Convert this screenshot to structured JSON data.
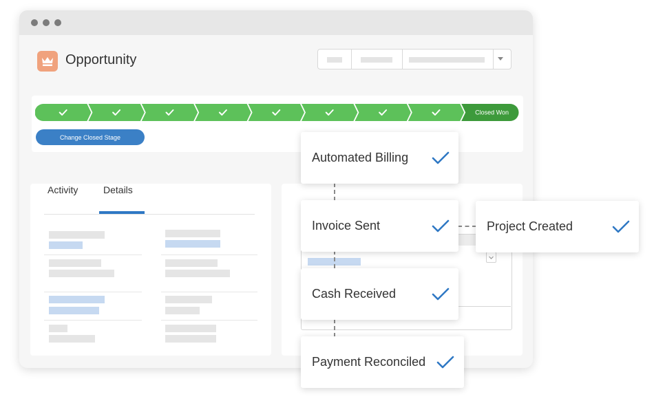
{
  "window": {
    "title": "Opportunity",
    "logo_icon": "crown-icon"
  },
  "stages": {
    "completed_count": 8,
    "final_label": "Closed Won",
    "completed_color": "#5dc15a",
    "final_color": "#3d9a3b"
  },
  "change_stage_button": "Change Closed Stage",
  "tabs": [
    {
      "label": "Activity",
      "active": false
    },
    {
      "label": "Details",
      "active": true
    }
  ],
  "workflow": {
    "automated_billing": "Automated Billing",
    "invoice_sent": "Invoice Sent",
    "project_created": "Project Created",
    "cash_received": "Cash Received",
    "payment_reconciled": "Payment Reconciled"
  },
  "colors": {
    "accent": "#2f78c4",
    "check": "#2f78c4"
  }
}
